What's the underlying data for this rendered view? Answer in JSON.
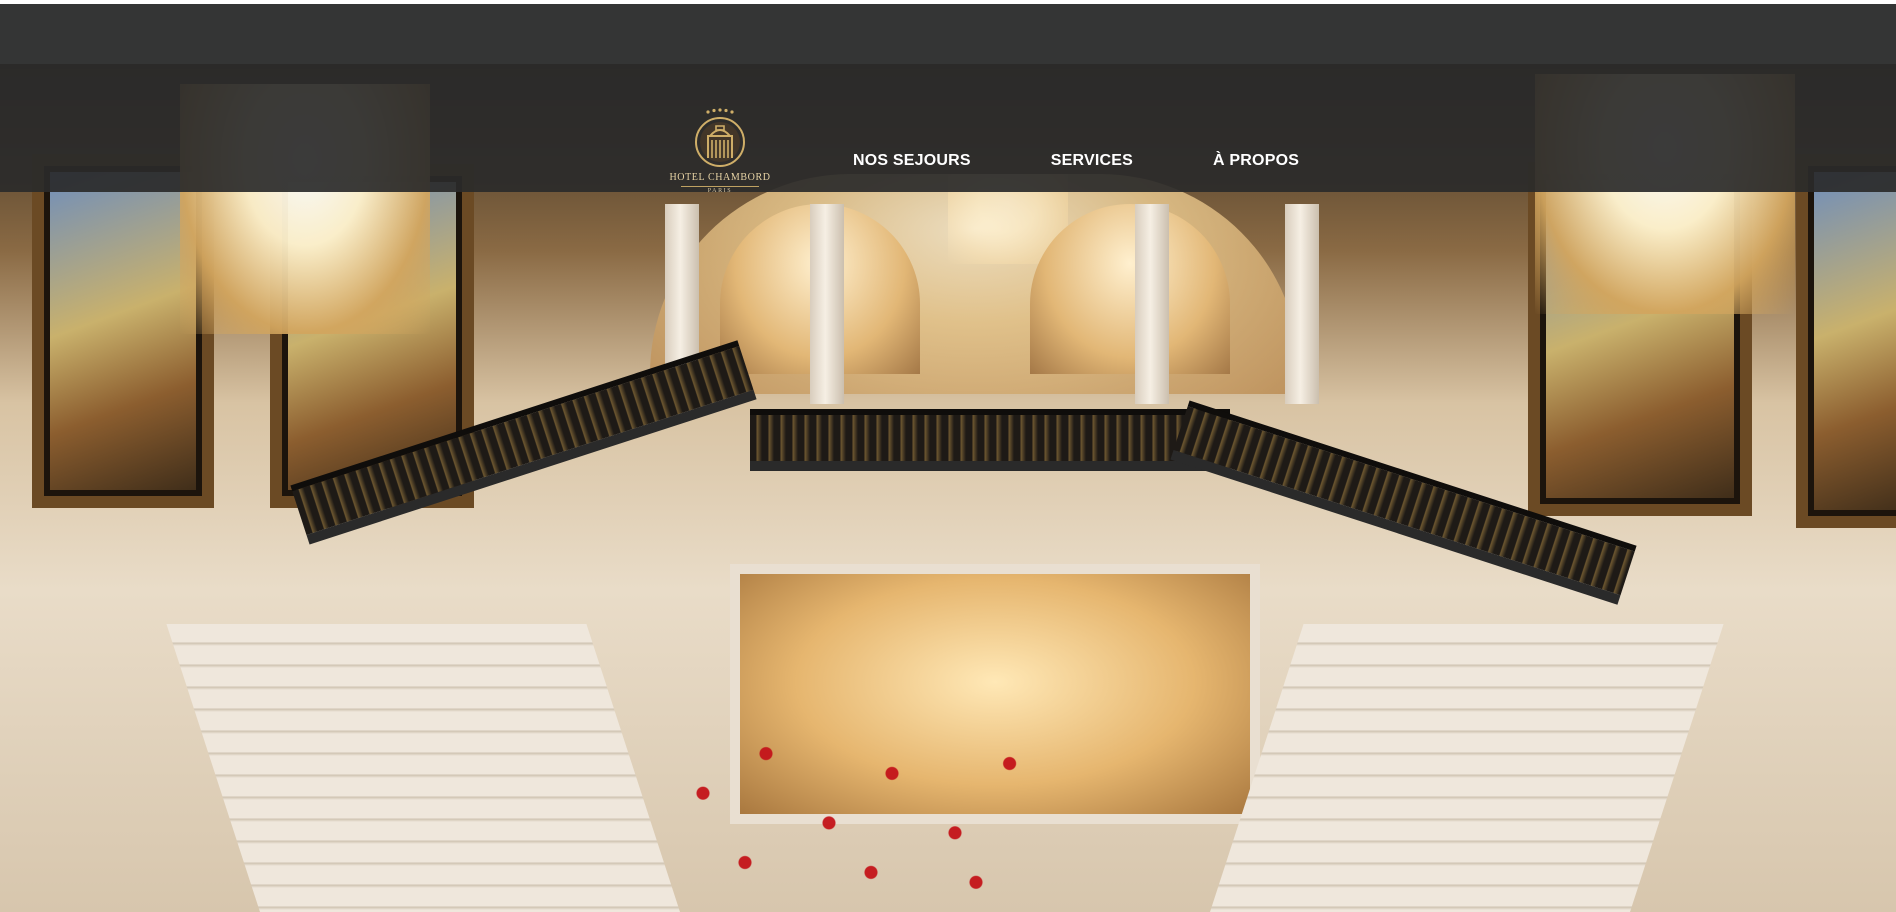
{
  "header": {
    "logo": {
      "icon": "hotel-crest-icon",
      "brand": "HOTEL CHAMBORD",
      "city": "PARIS"
    },
    "nav": {
      "items": [
        {
          "label": "NOS SEJOURS"
        },
        {
          "label": "SERVICES"
        },
        {
          "label": "À PROPOS"
        }
      ]
    }
  },
  "hero": {
    "image": "hotel-lobby-grand-staircase-photo"
  },
  "colors": {
    "topbar": "#343535",
    "header_overlay": "#2a2a2a",
    "nav_text": "#ffffff",
    "logo_gold": "#cfae68"
  }
}
